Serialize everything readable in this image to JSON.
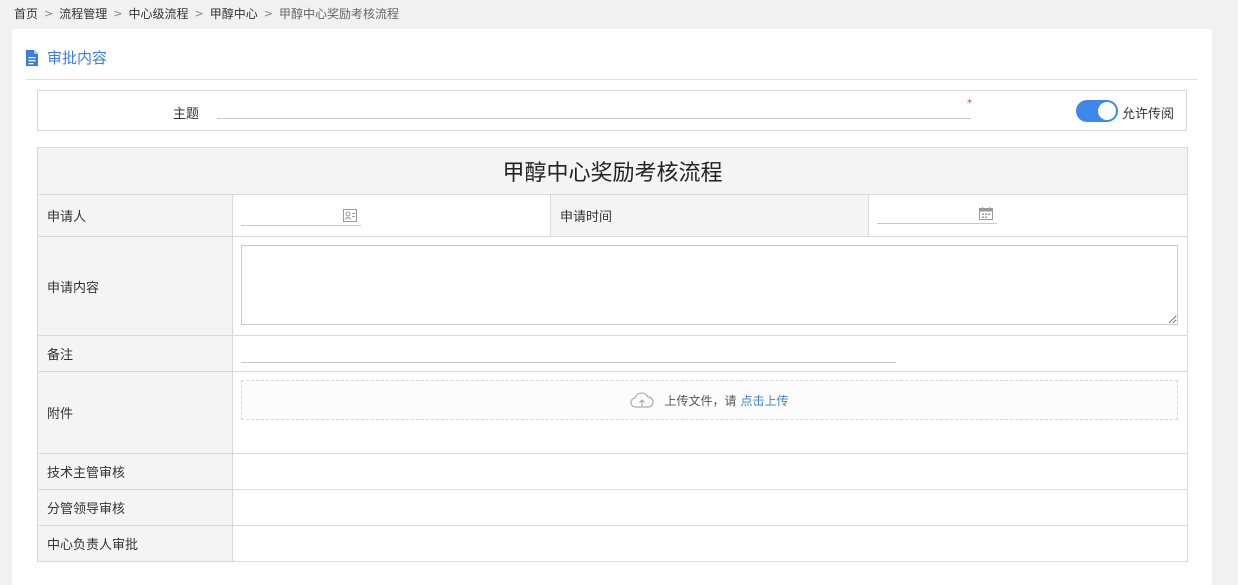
{
  "breadcrumb": {
    "items": [
      "首页",
      "流程管理",
      "中心级流程",
      "甲醇中心",
      "甲醇中心奖励考核流程"
    ]
  },
  "section": {
    "title": "审批内容"
  },
  "subject": {
    "label": "主题",
    "value": "",
    "required_mark": "*",
    "toggle_label": "允许传阅",
    "toggle_on": true
  },
  "form": {
    "title": "甲醇中心奖励考核流程",
    "applicant_label": "申请人",
    "applicant_value": "",
    "apply_time_label": "申请时间",
    "apply_time_value": "",
    "content_label": "申请内容",
    "content_value": "",
    "remark_label": "备注",
    "remark_value": "",
    "attachment_label": "附件",
    "upload_text": "上传文件，请",
    "upload_link": "点击上传",
    "tech_review_label": "技术主管审核",
    "leader_review_label": "分管领导审核",
    "center_approval_label": "中心负责人审批"
  },
  "colors": {
    "accent": "#3d7fd8",
    "toggle": "#3d86ea",
    "label_bg": "#f4f4f4",
    "border": "#d9d9d9",
    "required": "#ee3333"
  },
  "icons": [
    "document-icon",
    "contact-card-icon",
    "calendar-icon",
    "cloud-upload-icon",
    "chevron-right-icon"
  ]
}
